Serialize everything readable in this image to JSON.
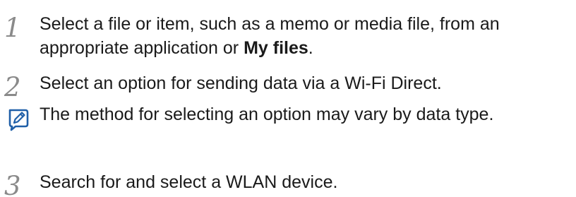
{
  "steps": [
    {
      "number": "1",
      "text_before": "Select a file or item, such as a memo or media file, from an appropriate application or ",
      "text_bold": "My files",
      "text_after": "."
    },
    {
      "number": "2",
      "text": "Select an option for sending data via a Wi-Fi Direct."
    },
    {
      "number": "3",
      "text": "Search for and select a WLAN device."
    }
  ],
  "note": {
    "icon": "note-pencil-icon",
    "text": "The method for selecting an option may vary by data type."
  },
  "colors": {
    "text": "#1a1a1a",
    "step_number": "#8a8a8a",
    "note_icon": "#1f5fa8"
  }
}
